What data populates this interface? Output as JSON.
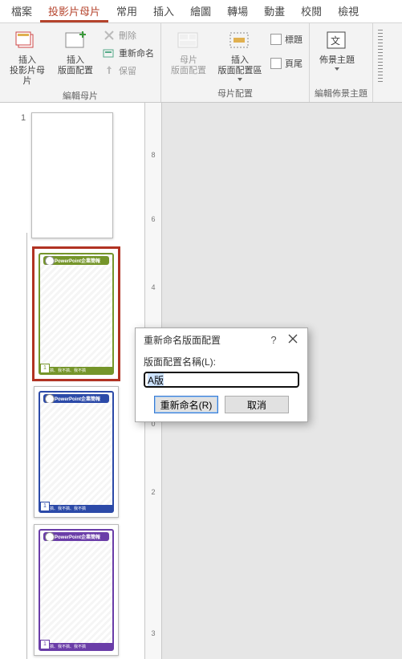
{
  "tabs": {
    "file": "檔案",
    "master": "投影片母片",
    "home": "常用",
    "insert": "插入",
    "draw": "繪圖",
    "transition": "轉場",
    "animation": "動畫",
    "review": "校閱",
    "view": "檢視"
  },
  "ribbon": {
    "insert_master": "插入\n投影片母片",
    "insert_layout": "插入\n版面配置",
    "delete": "刪除",
    "rename": "重新命名",
    "preserve": "保留",
    "group_edit_master": "編輯母片",
    "master_layout": "母片\n版面配置",
    "insert_placeholder": "插入\n版面配置區",
    "chk_title": "標題",
    "chk_footer": "頁尾",
    "group_master_layout": "母片配置",
    "themes": "佈景主題",
    "group_edit_theme": "編輯佈景主題"
  },
  "nav": {
    "master_index": "1"
  },
  "ruler_ticks": [
    "8",
    "6",
    "4",
    "2",
    "0",
    "2",
    "3"
  ],
  "dialog": {
    "title": "重新命名版面配置",
    "label": "版面配置名稱(L):",
    "value": "A版",
    "rename_btn": "重新命名(R)",
    "cancel_btn": "取消"
  },
  "thumb": {
    "title_text": "PowerPoint企業簡報",
    "footer_text": "我不搞、我不搞、我不搞"
  },
  "colors": {
    "green": "#75952a",
    "blue": "#2c4aa8",
    "purple": "#6a3da8"
  }
}
